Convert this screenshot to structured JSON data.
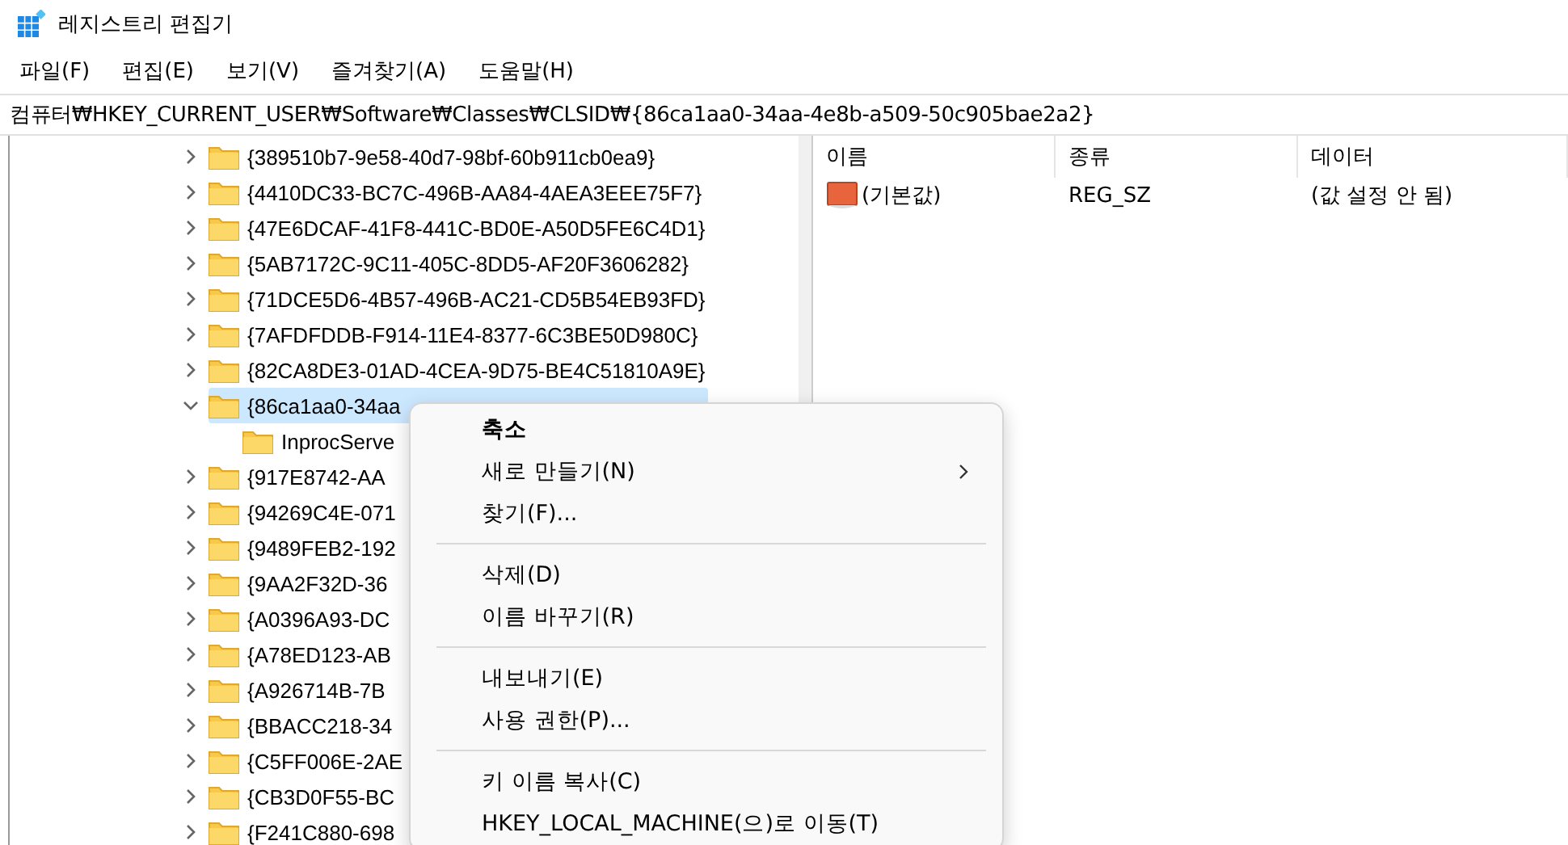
{
  "window": {
    "title": "레지스트리 편집기"
  },
  "menu_bar": [
    "파일(F)",
    "편집(E)",
    "보기(V)",
    "즐겨찾기(A)",
    "도움말(H)"
  ],
  "address": "컴퓨터₩HKEY_CURRENT_USER₩Software₩Classes₩CLSID₩{86ca1aa0-34aa-4e8b-a509-50c905bae2a2}",
  "tree": [
    {
      "label": "{389510b7-9e58-40d7-98bf-60b911cb0ea9}",
      "expanded": false,
      "selected": false
    },
    {
      "label": "{4410DC33-BC7C-496B-AA84-4AEA3EEE75F7}",
      "expanded": false,
      "selected": false
    },
    {
      "label": "{47E6DCAF-41F8-441C-BD0E-A50D5FE6C4D1}",
      "expanded": false,
      "selected": false
    },
    {
      "label": "{5AB7172C-9C11-405C-8DD5-AF20F3606282}",
      "expanded": false,
      "selected": false
    },
    {
      "label": "{71DCE5D6-4B57-496B-AC21-CD5B54EB93FD}",
      "expanded": false,
      "selected": false
    },
    {
      "label": "{7AFDFDDB-F914-11E4-8377-6C3BE50D980C}",
      "expanded": false,
      "selected": false
    },
    {
      "label": "{82CA8DE3-01AD-4CEA-9D75-BE4C51810A9E}",
      "expanded": false,
      "selected": false
    },
    {
      "label": "{86ca1aa0-34aa",
      "expanded": true,
      "selected": true,
      "children": [
        {
          "label": "InprocServe"
        }
      ]
    },
    {
      "label": "{917E8742-AA",
      "expanded": false,
      "selected": false
    },
    {
      "label": "{94269C4E-071",
      "expanded": false,
      "selected": false
    },
    {
      "label": "{9489FEB2-192",
      "expanded": false,
      "selected": false
    },
    {
      "label": "{9AA2F32D-36",
      "expanded": false,
      "selected": false
    },
    {
      "label": "{A0396A93-DC",
      "expanded": false,
      "selected": false
    },
    {
      "label": "{A78ED123-AB",
      "expanded": false,
      "selected": false
    },
    {
      "label": "{A926714B-7B",
      "expanded": false,
      "selected": false
    },
    {
      "label": "{BBACC218-34",
      "expanded": false,
      "selected": false
    },
    {
      "label": "{C5FF006E-2AE",
      "expanded": false,
      "selected": false
    },
    {
      "label": "{CB3D0F55-BC",
      "expanded": false,
      "selected": false
    },
    {
      "label": "{F241C880-698",
      "expanded": false,
      "selected": false
    }
  ],
  "values": {
    "columns": [
      "이름",
      "종류",
      "데이터"
    ],
    "rows": [
      {
        "name": "(기본값)",
        "type": "REG_SZ",
        "data": "(값 설정 안 됨)"
      }
    ]
  },
  "context_menu": [
    {
      "kind": "item",
      "label": "축소",
      "default": true
    },
    {
      "kind": "item",
      "label": "새로 만들기(N)",
      "submenu": true
    },
    {
      "kind": "item",
      "label": "찾기(F)..."
    },
    {
      "kind": "separator"
    },
    {
      "kind": "item",
      "label": "삭제(D)"
    },
    {
      "kind": "item",
      "label": "이름 바꾸기(R)"
    },
    {
      "kind": "separator"
    },
    {
      "kind": "item",
      "label": "내보내기(E)"
    },
    {
      "kind": "item",
      "label": "사용 권한(P)..."
    },
    {
      "kind": "separator"
    },
    {
      "kind": "item",
      "label": "키 이름 복사(C)"
    },
    {
      "kind": "item",
      "label": "HKEY_LOCAL_MACHINE(으)로 이동(T)"
    }
  ]
}
